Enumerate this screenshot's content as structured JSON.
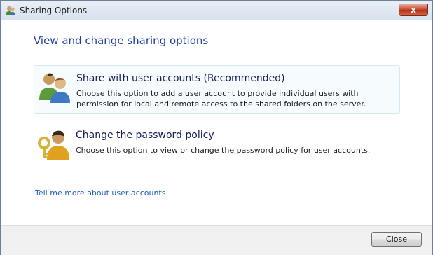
{
  "window": {
    "title": "Sharing Options",
    "close_glyph": "x"
  },
  "main": {
    "heading": "View and change sharing options",
    "options": [
      {
        "title": "Share with user accounts (Recommended)",
        "description": "Choose this option to add a user account to provide individual users with permission for local and remote access to the shared folders on the server.",
        "icon": "users-icon"
      },
      {
        "title": "Change the password policy",
        "description": "Choose this option to view or change the password policy for user accounts.",
        "icon": "user-key-icon"
      }
    ],
    "help_link": "Tell me more about user accounts"
  },
  "footer": {
    "close_label": "Close"
  },
  "colors": {
    "heading": "#1e3ea0",
    "link": "#1c5fb5",
    "option_title": "#151c55",
    "hover_border": "#d5e8f5"
  }
}
